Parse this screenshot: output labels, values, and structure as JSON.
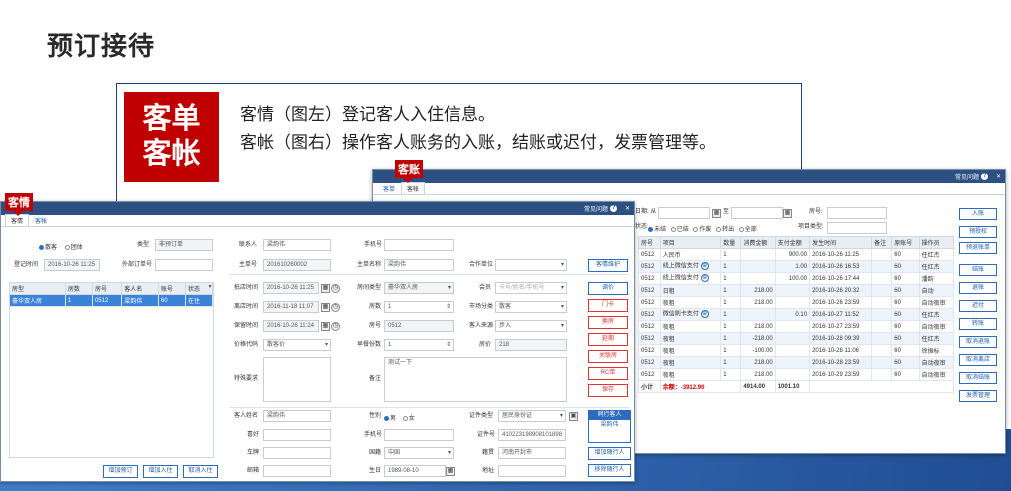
{
  "page": {
    "title": "预订接待"
  },
  "intro": {
    "badge_line1": "客单",
    "badge_line2": "客帐",
    "line1": "客情（图左）登记客人入住信息。",
    "line2": "客帐（图右）操作客人账务的入账，结账或迟付，发票管理等。"
  },
  "account": {
    "label": "客账",
    "tab1": "客单",
    "tab2": "客帐",
    "faq": "常见问题",
    "close": "✕",
    "f_from_lbl": "日期: 从",
    "f_to_lbl": "至",
    "f_room_lbl": "房号:",
    "f_item_lbl": "项目类型:",
    "status_lbl": "状态:",
    "statuses": [
      "未结",
      "已结",
      "作废",
      "转出",
      "全部"
    ],
    "columns": [
      "房号",
      "项目",
      "数量",
      "消费金额",
      "支付金额",
      "发生时间",
      "备注",
      "原账号",
      "操作员"
    ],
    "rows": [
      [
        "0512",
        "人民币",
        "1",
        "",
        "900.00",
        "2016-10-26 11:25",
        "",
        "60",
        "任红杰"
      ],
      [
        "0512",
        "线上微信支付",
        "1",
        "",
        "1.00",
        "2016-10-26 16:53",
        "",
        "60",
        "任红杰"
      ],
      [
        "0512",
        "线上微信支付",
        "1",
        "",
        "100.00",
        "2016-10-26 17:44",
        "",
        "60",
        "潘韵"
      ],
      [
        "0512",
        "日租",
        "1",
        "218.00",
        "",
        "2016-10-26 20:32",
        "",
        "60",
        "自动"
      ],
      [
        "0512",
        "夜租",
        "1",
        "218.00",
        "",
        "2016-10-26 23:59",
        "",
        "60",
        "自动夜审"
      ],
      [
        "0512",
        "微信刷卡支付",
        "1",
        "",
        "0.10",
        "2016-10-27 11:52",
        "",
        "60",
        "任红杰"
      ],
      [
        "0512",
        "夜租",
        "1",
        "218.00",
        "",
        "2016-10-27 23:59",
        "",
        "60",
        "自动夜审"
      ],
      [
        "0512",
        "夜租",
        "1",
        "-218.00",
        "",
        "2016-10-28 09:39",
        "",
        "60",
        "任红杰"
      ],
      [
        "0512",
        "夜租",
        "1",
        "-100.00",
        "",
        "2016-10-28 11:06",
        "",
        "60",
        "徐振标"
      ],
      [
        "0512",
        "夜租",
        "1",
        "218.00",
        "",
        "2016-10-28 23:59",
        "",
        "60",
        "自动夜审"
      ],
      [
        "0512",
        "夜租",
        "1",
        "218.00",
        "",
        "2016-10-29 23:59",
        "",
        "60",
        "自动夜审"
      ]
    ],
    "subtotal_lbl": "小计",
    "balance": "余额：-3912.90",
    "sum_consume": "4914.00",
    "sum_pay": "1001.10",
    "side_buttons": [
      "入账",
      "预授权",
      "预退账单",
      "结账",
      "退账",
      "迟付",
      "转账",
      "取消退账",
      "取消离店",
      "取消结账",
      "发票管理"
    ]
  },
  "guest": {
    "label": "客情",
    "tab1": "客情",
    "tab2": "客帐",
    "faq": "常见问题",
    "close": "✕",
    "r_group_lbl": "散客",
    "r_team_lbl": "团体",
    "type_lbl": "类型",
    "type_val": "非预订单",
    "reg_time_lbl": "登记时间",
    "reg_time_val": "2016-10-26 11:25",
    "ext_lbl": "外部订单号",
    "columns": [
      "房型",
      "房数",
      "房号",
      "客人名",
      "账号",
      "状态"
    ],
    "rows": [
      [
        "豪华双人房",
        "1",
        "0512",
        "梁韵伟",
        "60",
        "在住"
      ]
    ],
    "btn_add_booking": "增加预订",
    "btn_add_checkin": "增加入住",
    "btn_cancel_checkin": "取消入住",
    "contact_lbl": "联系人",
    "contact_val": "梁韵伟",
    "mobile_lbl": "手机号",
    "mobile_val": "",
    "main_no_lbl": "主单号",
    "main_no_val": "201610260002",
    "main_name_lbl": "主单名称",
    "main_name_val": "梁韵伟",
    "unit_lbl": "合作单位",
    "unit_val": "",
    "maintain_btn": "客情维护",
    "arrive_lbl": "抵店时间",
    "arrive_val": "2016-10-26 11:25",
    "room_type_lbl": "房间类型",
    "room_type_val": "豪华双人房",
    "member_lbl": "会员",
    "member_ph": "卡号/姓名/手机号",
    "leave_lbl": "离店时间",
    "leave_val": "2016-11-18 11:07",
    "rooms_lbl": "房数",
    "rooms_val": "1",
    "market_lbl": "市场分类",
    "market_val": "散客",
    "hold_lbl": "保留时间",
    "hold_val": "2016-10-26 11:24",
    "roomno_lbl": "房号",
    "roomno_val": "0512",
    "source_lbl": "客人来源",
    "source_val": "步入",
    "price_code_lbl": "价格代码",
    "price_code_val": "散客价",
    "breakfast_lbl": "早餐份数",
    "breakfast_val": "1",
    "price_lbl": "房价",
    "price_val": "218",
    "special_lbl": "特殊要求",
    "remark_lbl": "备注",
    "remark_val": "测试一下",
    "mid_buttons": [
      "调价",
      "门卡",
      "换房",
      "延期",
      "关联房",
      "RC单",
      "保存"
    ],
    "name_lbl": "客人姓名",
    "name_val": "梁韵伟",
    "gender_lbl": "性别",
    "male": "男",
    "female": "女",
    "idtype_lbl": "证件类型",
    "idtype_val": "居民身份证",
    "hobby_lbl": "喜好",
    "phone_lbl": "手机号",
    "idno_lbl": "证件号",
    "idno_val": "410223198908101898",
    "plate_lbl": "车牌",
    "country_lbl": "国籍",
    "country_val": "中国",
    "native_lbl": "籍贯",
    "native_val": "河南开封市",
    "mail_lbl": "邮箱",
    "birth_lbl": "生日",
    "birth_val": "1989-08-10",
    "addr_lbl": "地址",
    "companion_hdr": "同行客人",
    "companion_name": "梁韵伟",
    "add_companion": "增加随行人",
    "remove_companion": "移除随行人"
  }
}
